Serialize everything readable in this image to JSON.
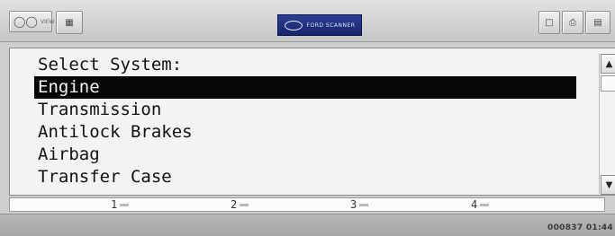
{
  "toolbar": {
    "view_button_label": "VIEW",
    "logo_text": "FORD SCANNER",
    "icons": [
      "view-icon",
      "grid-icon",
      "window-icon",
      "print-icon",
      "document-icon"
    ]
  },
  "menu": {
    "prompt": "Select System:",
    "items": [
      "Engine",
      "Transmission",
      "Antilock Brakes",
      "Airbag",
      "Transfer Case"
    ],
    "selected": "Engine"
  },
  "softkeys": [
    "1",
    "2",
    "3",
    "4"
  ],
  "status": {
    "time": "000837 01:44"
  },
  "colors": {
    "selection_bg": "#060606",
    "selection_fg": "#f5f5f5",
    "logo_bg": "#1f2f80"
  }
}
